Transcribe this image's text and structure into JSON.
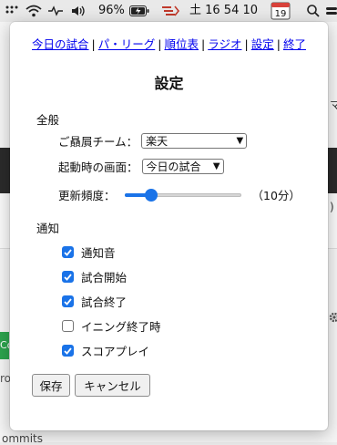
{
  "menubar": {
    "battery_percent": "96%",
    "time": "土 16 54 10",
    "calendar_day": "19"
  },
  "background": {
    "side_text_top": "マ",
    "side_text_mid": ")",
    "side_green": "Co",
    "side_text_low": "ro",
    "bottom_text": "ommits"
  },
  "popup": {
    "nav": {
      "items": [
        "今日の試合",
        "パ・リーグ",
        "順位表",
        "ラジオ",
        "設定",
        "終了"
      ],
      "separator": "|"
    },
    "title": "設定",
    "general": {
      "label": "全般",
      "favorite_team_label": "ご贔屓チーム：",
      "favorite_team_value": "楽天",
      "startup_screen_label": "起動時の画面：",
      "startup_screen_value": "今日の試合",
      "refresh_label": "更新頻度：",
      "refresh_value_text": "（10分）",
      "refresh_slider_fraction": 0.2
    },
    "notifications": {
      "label": "通知",
      "items": [
        {
          "label": "通知音",
          "checked": true
        },
        {
          "label": "試合開始",
          "checked": true
        },
        {
          "label": "試合終了",
          "checked": true
        },
        {
          "label": "イニング終了時",
          "checked": false
        },
        {
          "label": "スコアプレイ",
          "checked": true
        }
      ]
    },
    "buttons": {
      "save": "保存",
      "cancel": "キャンセル"
    }
  }
}
